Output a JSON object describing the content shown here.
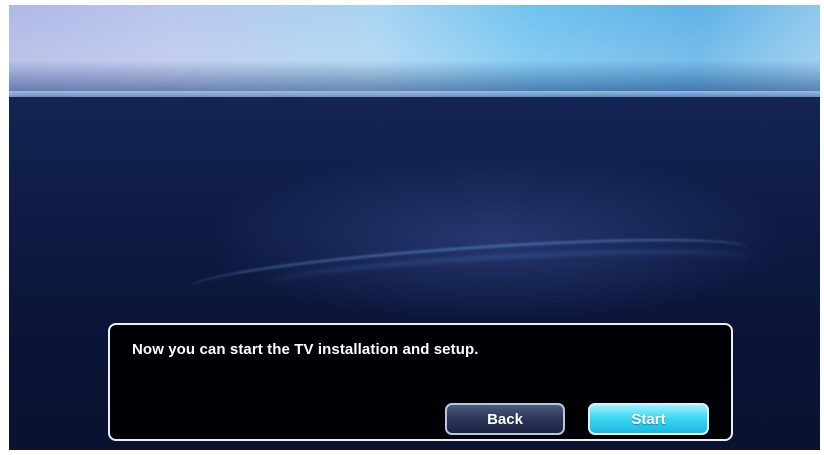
{
  "dialog": {
    "message": "Now you can start the TV installation and setup.",
    "back_label": "Back",
    "start_label": "Start"
  },
  "colors": {
    "start_button": "#3fd8f2",
    "back_button": "#2a3657",
    "background": "#0d1a42"
  }
}
